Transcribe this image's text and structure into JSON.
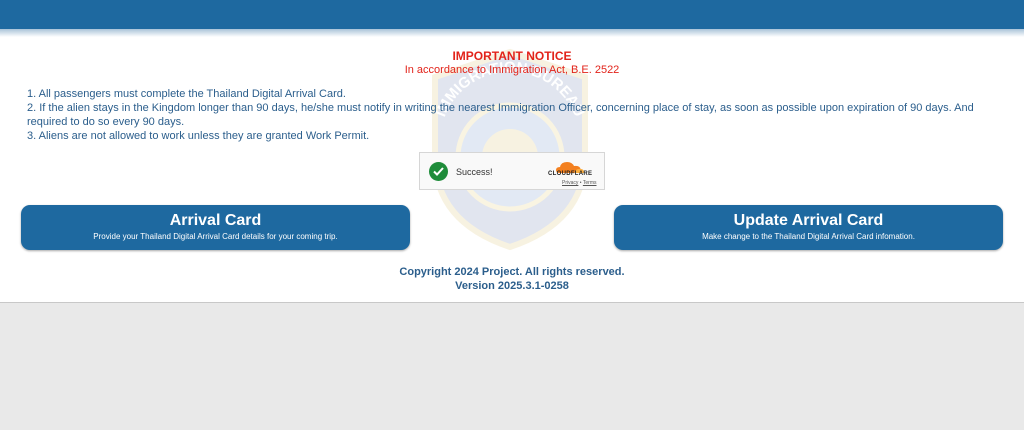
{
  "notice": {
    "title": "IMPORTANT NOTICE",
    "subtitle": "In accordance to Immigration Act, B.E. 2522",
    "rules": [
      "1. All passengers must complete the Thailand Digital Arrival Card.",
      "2. If the alien stays in the Kingdom longer than 90 days, he/she must notify in writing the nearest Immigration Officer, concerning place of stay, as soon as possible upon expiration of 90 days. And required to do so every 90 days.",
      "3. Aliens are not allowed to work unless they are granted Work Permit."
    ]
  },
  "watermark": {
    "text": "IMMIGRATION BUREAU"
  },
  "captcha": {
    "status": "Success!",
    "brand": "CLOUDFLARE",
    "privacy_label": "Privacy",
    "separator": "•",
    "terms_label": "Terms"
  },
  "buttons": {
    "arrival": {
      "title": "Arrival Card",
      "subtitle": "Provide your Thailand Digital Arrival Card details for your coming trip."
    },
    "update": {
      "title": "Update Arrival Card",
      "subtitle": "Make change to the Thailand Digital Arrival Card infomation."
    }
  },
  "footer": {
    "copyright": "Copyright 2024 Project. All rights reserved.",
    "version": "Version 2025.3.1-0258"
  },
  "colors": {
    "brand_blue": "#1e69a0",
    "notice_red": "#e2231a",
    "text_blue": "#2b5e8c",
    "success_green": "#1e8c3a",
    "cloudflare_orange": "#f38020"
  },
  "icons": {
    "success": "check-circle-icon",
    "cloudflare": "cloud-icon"
  }
}
